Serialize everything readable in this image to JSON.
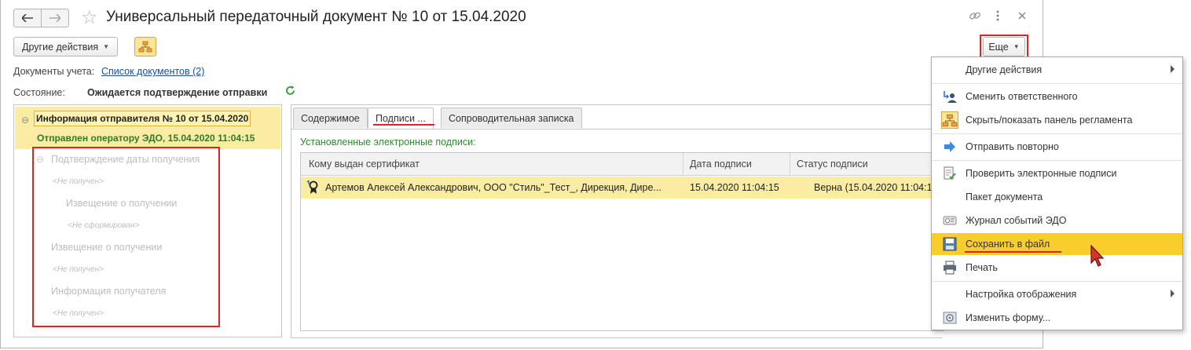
{
  "window": {
    "title": "Универсальный передаточный документ № 10 от 15.04.2020"
  },
  "toolbar": {
    "other_actions": "Другие действия",
    "more": "Еще"
  },
  "docs": {
    "label": "Документы учета:",
    "link": "Список документов (2)"
  },
  "state": {
    "label": "Состояние:",
    "value": "Ожидается подтверждение отправки"
  },
  "tree": {
    "selected_title": "Информация отправителя № 10 от 15.04.2020",
    "selected_status": "Отправлен оператору ЭДО, 15.04.2020 11:04:15",
    "items": [
      {
        "label": "Подтверждение даты получения"
      },
      {
        "label": "<Не получен>"
      },
      {
        "label": "Извещение о получении"
      },
      {
        "label": "<Не сформирован>"
      },
      {
        "label": "Извещение о получении"
      },
      {
        "label": "<Не получен>"
      },
      {
        "label": "Информация получателя"
      },
      {
        "label": "<Не получен>"
      }
    ]
  },
  "tabs": [
    {
      "label": "Содержимое"
    },
    {
      "label": "Подписи ..."
    },
    {
      "label": "Сопроводительная записка"
    }
  ],
  "signatures": {
    "caption": "Установленные электронные подписи:",
    "columns": [
      "Кому выдан сертификат",
      "Дата подписи",
      "Статус подписи"
    ],
    "rows": [
      {
        "holder": "Артемов Алексей Александрович, ООО \"Стиль\"_Тест_, Дирекция, Дире...",
        "date": "15.04.2020 11:04:15",
        "status": "Верна (15.04.2020 11:04:15)"
      }
    ]
  },
  "menu": {
    "items": [
      {
        "label": "Другие действия",
        "icon": "none",
        "submenu": true
      },
      {
        "label": "Сменить ответственного",
        "icon": "change-user-icon"
      },
      {
        "label": "Скрыть/показать панель регламента",
        "icon": "schema-icon"
      },
      {
        "label": "Отправить повторно",
        "icon": "arrow-right-icon"
      },
      {
        "label": "Проверить электронные подписи",
        "icon": "check-signature-icon"
      },
      {
        "label": "Пакет документа",
        "icon": "none"
      },
      {
        "label": "Журнал событий ЭДО",
        "icon": "log-icon"
      },
      {
        "label": "Сохранить в файл",
        "icon": "save-file-icon",
        "highlighted": true
      },
      {
        "label": "Печать",
        "icon": "printer-icon"
      },
      {
        "label": "Настройка отображения",
        "icon": "none",
        "submenu": true
      },
      {
        "label": "Изменить форму...",
        "icon": "form-settings-icon"
      }
    ]
  },
  "colors": {
    "accent_yellow": "#f8cd2c",
    "selection": "#fbeca4",
    "annotation_red": "#e02424",
    "status_green": "#2c7a2c",
    "link_blue": "#1b4fa3"
  }
}
